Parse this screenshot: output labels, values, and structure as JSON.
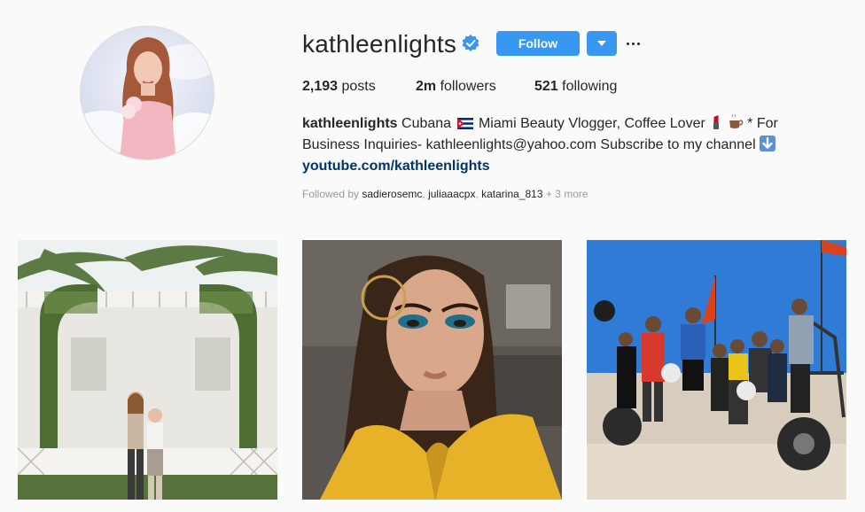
{
  "profile": {
    "username": "kathleenlights",
    "verified": true,
    "follow_label": "Follow",
    "accent_color": "#3897f0"
  },
  "stats": {
    "posts_count": "2,193",
    "posts_label": " posts",
    "followers_count": "2m",
    "followers_label": " followers",
    "following_count": "521",
    "following_label": " following"
  },
  "bio": {
    "name": "kathleenlights",
    "line1_a": " Cubana ",
    "line1_b": " Miami Beauty Vlogger, Coffee Lover ",
    "line1_c": " * For",
    "line2": "Business Inquiries- kathleenlights@yahoo.com Subscribe to my channel ",
    "link": "youtube.com/kathleenlights"
  },
  "followed_by": {
    "prefix": "Followed by ",
    "users": [
      "sadierosemc",
      "juliaaacpx",
      "katarina_813"
    ],
    "more": " + 3 more"
  },
  "icons": [
    "verified-badge-icon",
    "chevron-down-icon",
    "more-options-icon",
    "cuba-flag-icon",
    "lipstick-icon",
    "coffee-icon",
    "down-arrow-icon"
  ]
}
